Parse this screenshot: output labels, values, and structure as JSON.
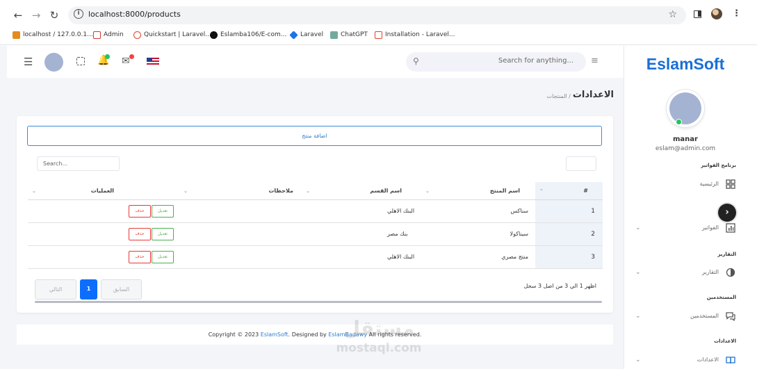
{
  "browser": {
    "url": "localhost:8000/products",
    "bookmarks": [
      {
        "label": "localhost / 127.0.0.1...",
        "icon": "phpmyadmin-icon"
      },
      {
        "label": "Admin",
        "icon": "admin-icon"
      },
      {
        "label": "Quickstart | Laravel...",
        "icon": "laravel-icon"
      },
      {
        "label": "Eslamba106/E-com...",
        "icon": "github-icon"
      },
      {
        "label": "Laravel",
        "icon": "laravel-diamond-icon"
      },
      {
        "label": "ChatGPT",
        "icon": "chatgpt-icon"
      },
      {
        "label": "Installation - Laravel...",
        "icon": "laravel-icon"
      }
    ]
  },
  "topbar": {
    "search_placeholder": "Search for anything..."
  },
  "page": {
    "title": "الاعدادات",
    "breadcrumb": "/ المنتجات"
  },
  "card": {
    "add_button": "اضافة منتج",
    "search_placeholder": "Search...",
    "columns": {
      "num": "#",
      "product_name": "اسم المنتج",
      "department": "اسم القسم",
      "notes": "ملاحظات",
      "actions": "العمليات"
    },
    "rows": [
      {
        "num": "1",
        "product_name": "سناكس",
        "department": "البنك الاهلي"
      },
      {
        "num": "2",
        "product_name": "سيناكولا",
        "department": "بنك مصر"
      },
      {
        "num": "3",
        "product_name": "منتج مصري",
        "department": "البنك الاهلي"
      }
    ],
    "edit_label": "تعديل",
    "delete_label": "حذف",
    "info": "اظهر 1 الي 3 من اصل 3 سجل",
    "pagination": {
      "prev": "السابق",
      "current": "1",
      "next": "التالي"
    }
  },
  "footer": {
    "text_prefix": "Copyright © 2023 ",
    "brand": "EslamSoft",
    "text_mid": ". Designed by ",
    "designer": "EslamBadawy",
    "text_suffix": " All rights reserved."
  },
  "watermark": {
    "arabic": "مستقل",
    "latin": "mostaql.com"
  },
  "sidebar": {
    "brand": "EslamSoft",
    "user_name": "manar",
    "user_email": "eslam@admin.com",
    "sections": [
      {
        "title": "برنامج الفواتير",
        "item": "الرئيسية",
        "icon": "dashboard-icon",
        "has_chevron": false
      },
      {
        "title": "",
        "item": "الفواتير",
        "icon": "chart-bar-icon",
        "has_chevron": true
      },
      {
        "title": "التقارير",
        "item": "التقارير",
        "icon": "pie-chart-icon",
        "has_chevron": true
      },
      {
        "title": "المستخدمين",
        "item": "المستخدمين",
        "icon": "chat-icon",
        "has_chevron": true
      },
      {
        "title": "الاعدادات",
        "item": "الاعدادات",
        "icon": "book-icon",
        "has_chevron": true
      }
    ]
  },
  "colors": {
    "brand": "#1a6fd6",
    "primary": "#0d6efd",
    "edit": "#4caf50",
    "delete": "#e53935",
    "online": "#22c55e"
  }
}
